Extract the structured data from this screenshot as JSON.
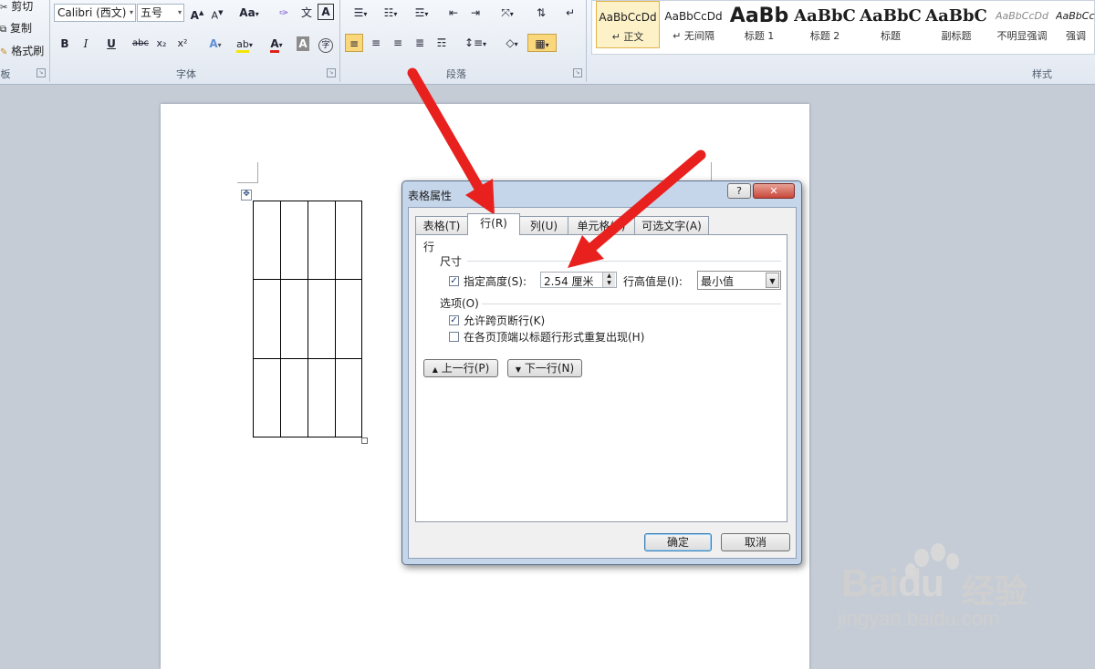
{
  "ribbon": {
    "clipboard": {
      "cut": "剪切",
      "copy": "复制",
      "format_painter": "格式刷",
      "label": "板"
    },
    "font": {
      "label": "字体",
      "font_name": "Calibri (西文)",
      "font_size": "五号",
      "grow": "A",
      "shrink": "A",
      "change_case": "Aa",
      "clear_format": "",
      "bold": "B",
      "italic": "I",
      "underline": "U",
      "strike": "abc",
      "subscript": "x₂",
      "superscript": "x²",
      "font_color": "A",
      "char_shade": "A",
      "enclose": "字",
      "phonetic": "文"
    },
    "paragraph": {
      "label": "段落"
    },
    "styles": {
      "label": "样式",
      "items": [
        {
          "sample": "AaBbCcDd",
          "name": "↵ 正文"
        },
        {
          "sample": "AaBbCcDd",
          "name": "↵ 无间隔"
        },
        {
          "sample": "AaBb",
          "name": "标题 1"
        },
        {
          "sample": "AaBbC",
          "name": "标题 2"
        },
        {
          "sample": "AaBbC",
          "name": "标题"
        },
        {
          "sample": "AaBbC",
          "name": "副标题"
        },
        {
          "sample": "AaBbCcDd",
          "name": "不明显强调"
        },
        {
          "sample": "AaBbCcDd",
          "name": "强调"
        }
      ]
    }
  },
  "dialog": {
    "title": "表格属性",
    "help": "?",
    "close": "✕",
    "tabs": [
      "表格(T)",
      "行(R)",
      "列(U)",
      "单元格(E)",
      "可选文字(A)"
    ],
    "section_row": "行",
    "section_size": "尺寸",
    "specify_height_label": "指定高度(S):",
    "specify_height_checked": true,
    "height_value": "2.54 厘米",
    "row_height_is_label": "行高值是(I):",
    "row_height_is_value": "最小值",
    "section_options": "选项(O)",
    "option_break_label": "允许跨页断行(K)",
    "option_break_checked": true,
    "option_repeat_label": "在各页顶端以标题行形式重复出现(H)",
    "option_repeat_checked": false,
    "prev_row": "上一行(P)",
    "next_row": "下一行(N)",
    "ok": "确定",
    "cancel": "取消"
  },
  "watermark": {
    "brand": "Bai",
    "brand2": "du",
    "jingyan": "经验",
    "url": "jingyan.baidu.com"
  },
  "colors": {
    "arrow": "#e8211f",
    "ribbon_bg": "#e2e8f1",
    "dialog_frame": "#c6d6ea"
  }
}
